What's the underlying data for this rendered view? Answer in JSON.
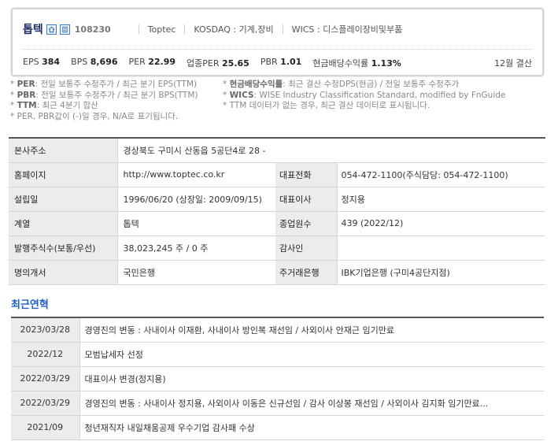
{
  "header": {
    "name": "톱텍",
    "code": "108230",
    "english_name": "Toptec",
    "market": "KOSDAQ : 기계,장비",
    "wics": "WICS : 디스플레이장비및부품",
    "icons": [
      "home-icon",
      "document-icon"
    ]
  },
  "metrics": [
    {
      "label": "EPS",
      "value": "384"
    },
    {
      "label": "BPS",
      "value": "8,696"
    },
    {
      "label": "PER",
      "value": "22.99"
    },
    {
      "label": "업종PER",
      "value": "25.65"
    },
    {
      "label": "PBR",
      "value": "1.01"
    },
    {
      "label": "현금배당수익률",
      "value": "1.13%"
    }
  ],
  "fiscal": "12월 결산",
  "notes": {
    "left": [
      {
        "key": "PER",
        "text": ": 전일 보통주 수정주가 / 최근 분기 EPS(TTM)"
      },
      {
        "key": "PBR",
        "text": ": 전일 보통주 수정주가 / 최근 분기 BPS(TTM)"
      },
      {
        "key": "TTM",
        "text": ": 최근 4분기 합산"
      }
    ],
    "right": [
      {
        "key": "현금배당수익률",
        "text": ": 최근 결산 수정DPS(현금) / 전일 보통주 수정주가"
      },
      {
        "key": "WICS",
        "text": ": WISE Industry Classification Standard, modified by FnGuide"
      },
      {
        "key": "",
        "text": "TTM 데이터가 없는 경우, 최근 결산 데이터로 표시됩니다."
      }
    ],
    "footer": "* PER, PBR값이 (-)일 경우, N/A로 표기됩니다."
  },
  "info": {
    "address_label": "본사주소",
    "address": "경상북도 구미시 산동읍 5공단4로 28 -",
    "homepage_label": "홈페이지",
    "homepage": "http://www.toptec.co.kr",
    "phone_label": "대표전화",
    "phone": "054-472-1100(주식담당: 054-472-1100)",
    "established_label": "설립일",
    "established": "1996/06/20 (상장일: 2009/09/15)",
    "ceo_label": "대표이사",
    "ceo": "정지용",
    "group_label": "계열",
    "group": "톱텍",
    "employees_label": "종업원수",
    "employees": "439 (2022/12)",
    "shares_label": "발행주식수(보통/우선)",
    "shares": "38,023,245 주 / 0 주",
    "auditor_label": "감사인",
    "auditor": "",
    "transfer_label": "명의개서",
    "transfer": "국민은행",
    "bank_label": "주거래은행",
    "bank": "IBK기업은행 (구미4공단지점)"
  },
  "history": {
    "title": "최근연혁",
    "rows": [
      {
        "date": "2023/03/28",
        "event": "경영진의 변동 : 사내이사 이재환, 사내이사 방인복 재선임 / 사외이사 안재근 임기만료"
      },
      {
        "date": "2022/12",
        "event": "모범납세자 선정"
      },
      {
        "date": "2022/03/29",
        "event": "대표이사 변경(정지용)"
      },
      {
        "date": "2022/03/29",
        "event": "경영진의 변동 : 사내이사 정지용, 사외이사 이동은 신규선임 / 감사 이상봉 재선임 / 사외이사 김지화 임기만료..."
      },
      {
        "date": "2021/09",
        "event": "청년재직자 내일채움공제 우수기업 감사패 수상"
      }
    ]
  }
}
